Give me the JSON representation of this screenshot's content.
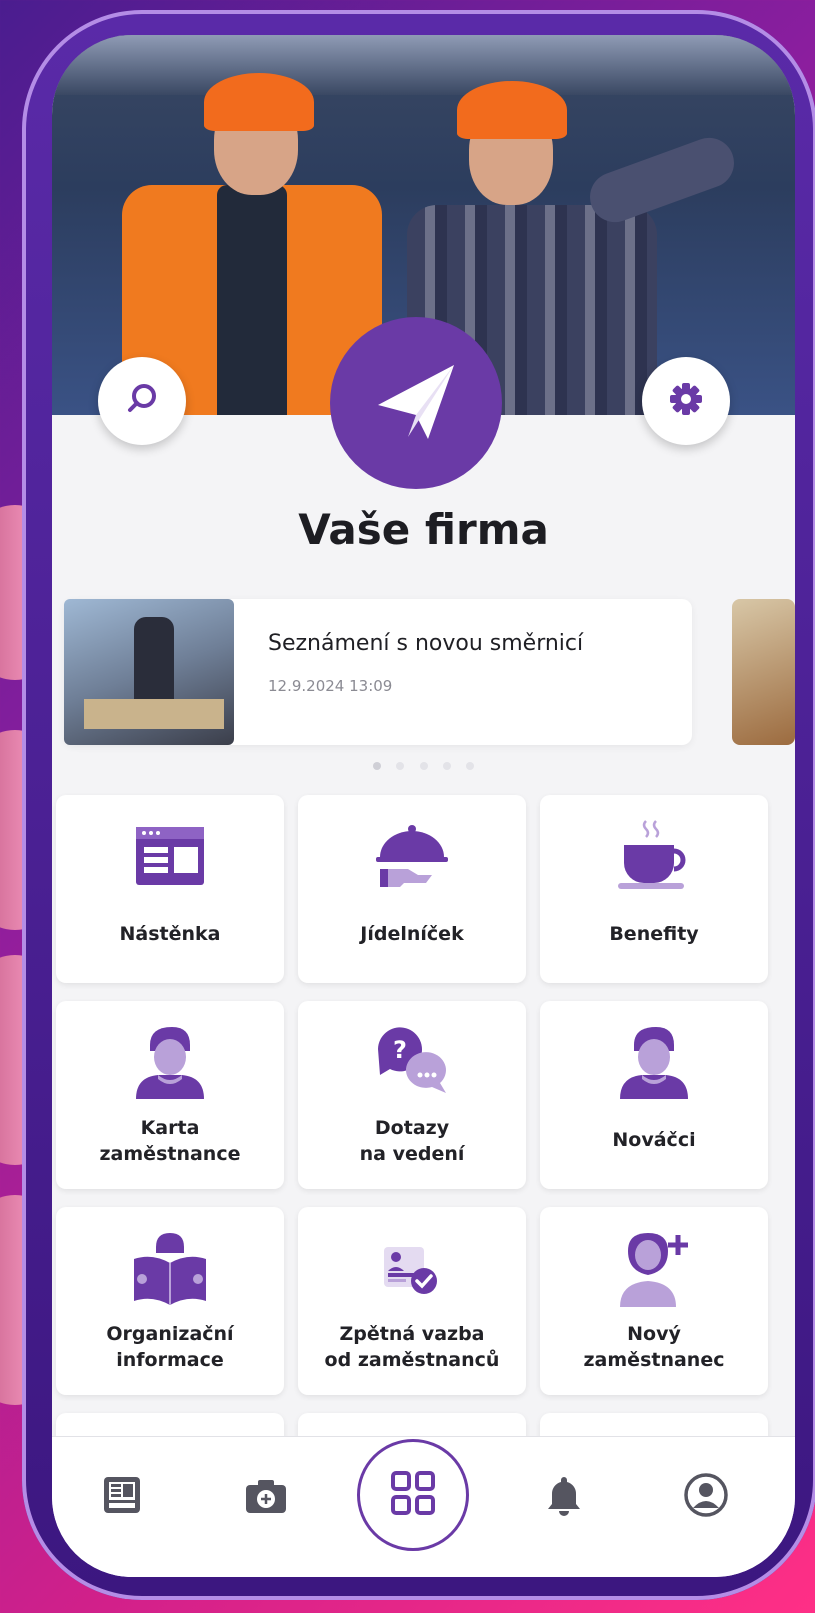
{
  "header": {
    "title": "Vaše firma",
    "search_icon": "search-icon",
    "settings_icon": "gear-icon",
    "logo_icon": "paper-plane-icon"
  },
  "news": {
    "title": "Seznámení s novou směrnicí",
    "date": "12.9.2024 13:09",
    "page_count": 5,
    "active_page": 1
  },
  "tiles": [
    {
      "label": "Nástěnka",
      "icon": "bulletin-board-icon"
    },
    {
      "label": "Jídelníček",
      "icon": "food-cloche-icon"
    },
    {
      "label": "Benefity",
      "icon": "coffee-cup-icon"
    },
    {
      "label": "Karta\nzaměstnance",
      "icon": "employee-card-icon"
    },
    {
      "label": "Dotazy\nna vedení",
      "icon": "questions-chat-icon"
    },
    {
      "label": "Nováčci",
      "icon": "newcomers-icon"
    },
    {
      "label": "Organizační\ninformace",
      "icon": "reading-book-icon"
    },
    {
      "label": "Zpětná vazba\nod zaměstnanců",
      "icon": "feedback-check-icon"
    },
    {
      "label": "Nový\nzaměstnanec",
      "icon": "add-employee-icon"
    }
  ],
  "bottom_nav": [
    {
      "icon": "news-feed-icon"
    },
    {
      "icon": "camera-icon"
    },
    {
      "icon": "grid-menu-icon"
    },
    {
      "icon": "bell-icon"
    },
    {
      "icon": "profile-icon"
    }
  ],
  "colors": {
    "accent": "#6a3aa6",
    "accent_light": "#b9a1d9",
    "background": "#f4f4f6"
  }
}
